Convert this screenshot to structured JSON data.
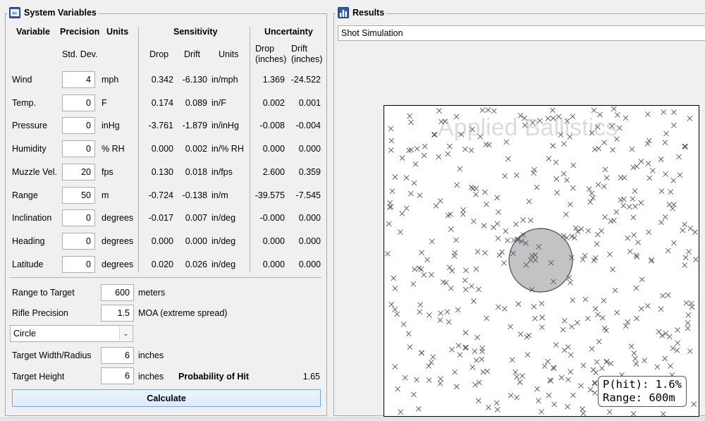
{
  "system_variables": {
    "title": "System Variables",
    "header": {
      "variable": "Variable",
      "precision": "Precision",
      "units": "Units",
      "sensitivity": "Sensitivity",
      "uncertainty": "Uncertainty",
      "std_dev": "Std. Dev.",
      "drop": "Drop",
      "drift": "Drift",
      "units2": "Units",
      "drop_in": "Drop\n(inches)",
      "drift_in": "Drift\n(inches)"
    },
    "rows": [
      {
        "name": "Wind",
        "value": "4",
        "unit": "mph",
        "drop": "0.342",
        "drift": "-6.130",
        "sunit": "in/mph",
        "udrop": "1.369",
        "udrift": "-24.522"
      },
      {
        "name": "Temp.",
        "value": "0",
        "unit": "F",
        "drop": "0.174",
        "drift": "0.089",
        "sunit": "in/F",
        "udrop": "0.002",
        "udrift": "0.001"
      },
      {
        "name": "Pressure",
        "value": "0",
        "unit": "inHg",
        "drop": "-3.761",
        "drift": "-1.879",
        "sunit": "in/inHg",
        "udrop": "-0.008",
        "udrift": "-0.004"
      },
      {
        "name": "Humidity",
        "value": "0",
        "unit": "% RH",
        "drop": "0.000",
        "drift": "0.002",
        "sunit": "in/% RH",
        "udrop": "0.000",
        "udrift": "0.000"
      },
      {
        "name": "Muzzle Vel.",
        "value": "20",
        "unit": "fps",
        "drop": "0.130",
        "drift": "0.018",
        "sunit": "in/fps",
        "udrop": "2.600",
        "udrift": "0.359"
      },
      {
        "name": "Range",
        "value": "50",
        "unit": "m",
        "drop": "-0.724",
        "drift": "-0.138",
        "sunit": "in/m",
        "udrop": "-39.575",
        "udrift": "-7.545"
      },
      {
        "name": "Inclination",
        "value": "0",
        "unit": "degrees",
        "drop": "-0.017",
        "drift": "0.007",
        "sunit": "in/deg",
        "udrop": "-0.000",
        "udrift": "0.000"
      },
      {
        "name": "Heading",
        "value": "0",
        "unit": "degrees",
        "drop": "0.000",
        "drift": "0.000",
        "sunit": "in/deg",
        "udrop": "0.000",
        "udrift": "0.000"
      },
      {
        "name": "Latitude",
        "value": "0",
        "unit": "degrees",
        "drop": "0.020",
        "drift": "0.026",
        "sunit": "in/deg",
        "udrop": "0.000",
        "udrift": "0.000"
      }
    ],
    "range_to_target": {
      "label": "Range to Target",
      "value": "600",
      "unit": "meters"
    },
    "rifle_precision": {
      "label": "Rifle Precision",
      "value": "1.5",
      "unit": "MOA (extreme spread)"
    },
    "shape": {
      "selected": "Circle"
    },
    "target_width": {
      "label": "Target Width/Radius",
      "value": "6",
      "unit": "inches"
    },
    "target_height": {
      "label": "Target Height",
      "value": "6",
      "unit": "inches"
    },
    "probability": {
      "label": "Probability of Hit",
      "value": "1.65"
    },
    "calculate_label": "Calculate"
  },
  "results": {
    "title": "Results",
    "selected_view": "Shot Simulation",
    "watermark": "Applied Ballistics",
    "p_hit": "P(hit): 1.6%",
    "range": "Range: 600m",
    "target_radius_in": 6,
    "hit_probability_pct": 1.6
  }
}
